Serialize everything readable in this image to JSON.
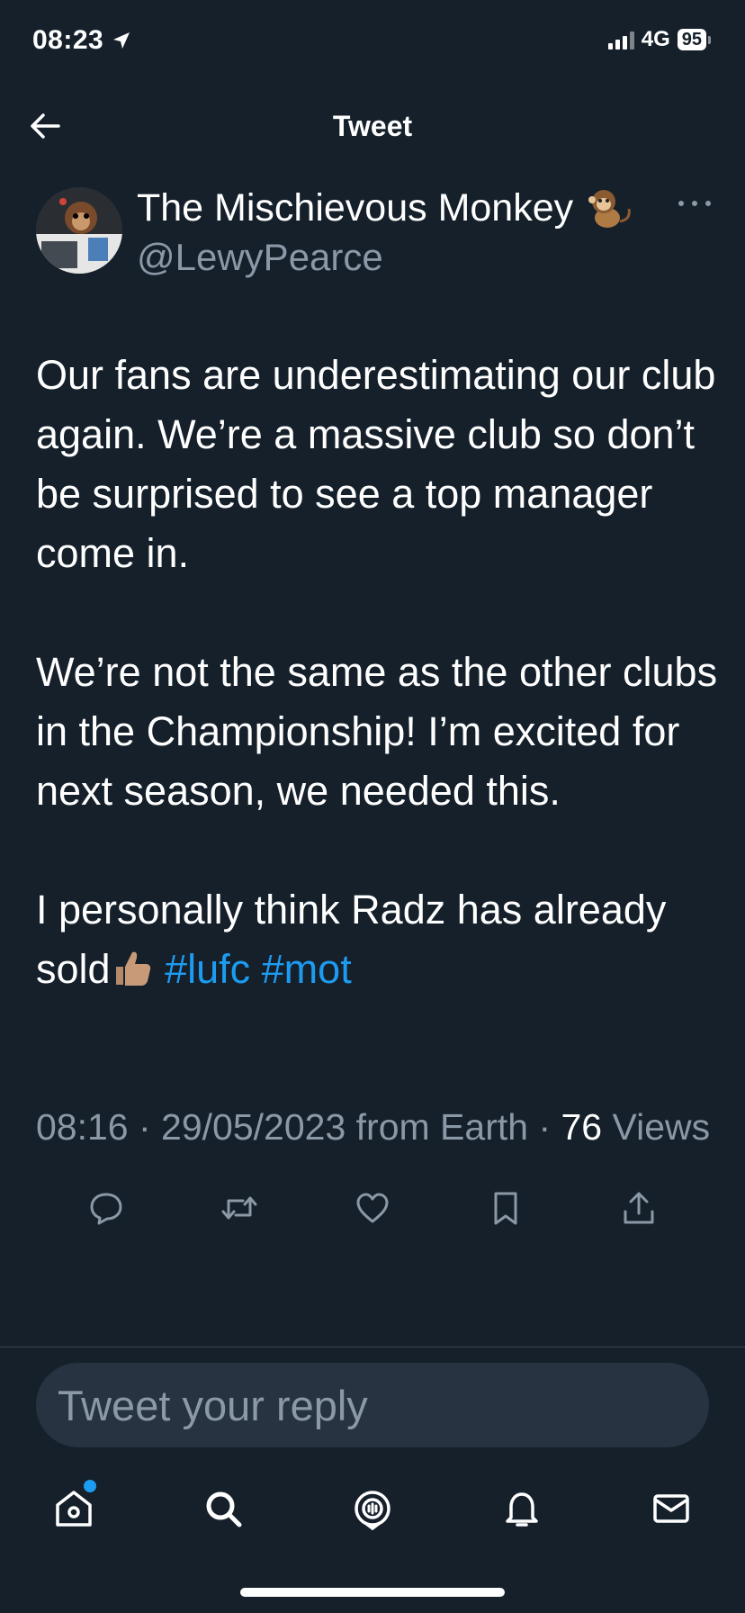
{
  "status_bar": {
    "time": "08:23",
    "network": "4G",
    "battery": "95"
  },
  "header": {
    "title": "Tweet"
  },
  "author": {
    "display_name": "The Mischievous Monkey",
    "handle": "@LewyPearce"
  },
  "tweet": {
    "paragraph_1": "Our fans are underestimating our club again. We’re a massive club so don’t be surprised to see a top manager come in.",
    "paragraph_2": "We’re not the same as the other clubs in the Championship! I’m excited for next season, we needed this.",
    "paragraph_3_text": "I personally think Radz has already sold",
    "hashtags": [
      "#lufc",
      "#mot"
    ]
  },
  "meta": {
    "time": "08:16",
    "date": "29/05/2023",
    "source": "from Earth",
    "views_count": "76",
    "views_label": "Views"
  },
  "reply": {
    "placeholder": "Tweet your reply"
  },
  "icons": {
    "back": "arrow-left-icon",
    "more": "more-horizontal-icon",
    "reply": "reply-icon",
    "retweet": "retweet-icon",
    "like": "heart-icon",
    "bookmark": "bookmark-icon",
    "share": "share-icon",
    "nav_home": "home-icon",
    "nav_search": "search-icon",
    "nav_spaces": "spaces-icon",
    "nav_notifications": "bell-icon",
    "nav_messages": "mail-icon"
  },
  "colors": {
    "background": "#15202B",
    "accent": "#1D9BF0",
    "secondary_text": "#8B98A5",
    "divider": "#38444D"
  }
}
